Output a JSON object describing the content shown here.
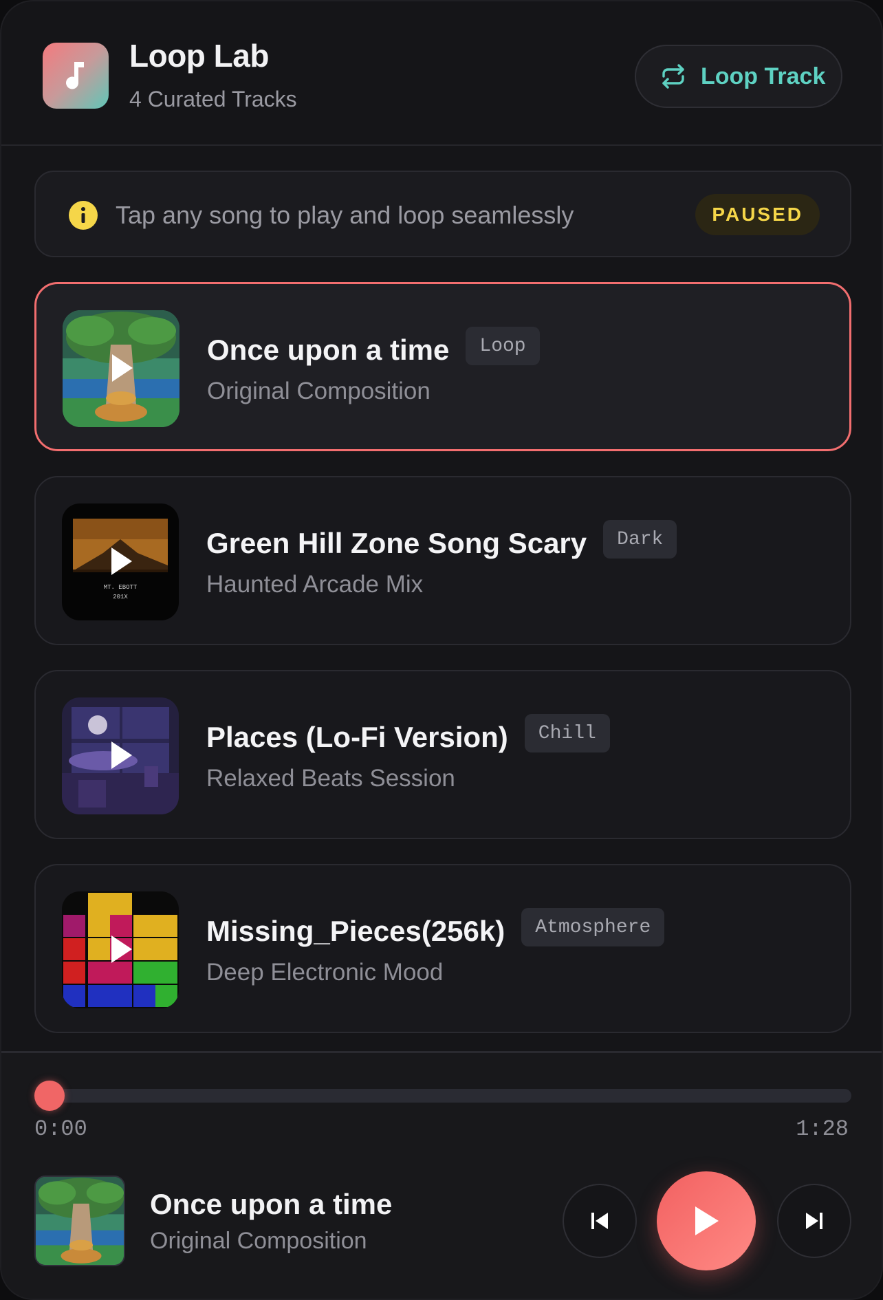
{
  "header": {
    "title": "Loop Lab",
    "subtitle": "4 Curated Tracks",
    "loop_button_label": "Loop Track",
    "logo_icon": "music-note-icon"
  },
  "banner": {
    "text": "Tap any song to play and loop seamlessly",
    "status": "PAUSED",
    "icon": "info-icon"
  },
  "tracks": [
    {
      "title": "Once upon a time",
      "tag": "Loop",
      "subtitle": "Original Composition",
      "active": true
    },
    {
      "title": "Green Hill Zone Song Scary",
      "tag": "Dark",
      "subtitle": "Haunted Arcade Mix",
      "art_text_1": "MT. EBOTT",
      "art_text_2": "201X"
    },
    {
      "title": "Places (Lo-Fi Version)",
      "tag": "Chill",
      "subtitle": "Relaxed Beats Session"
    },
    {
      "title": "Missing_Pieces(256k)",
      "tag": "Atmosphere",
      "subtitle": "Deep Electronic Mood"
    }
  ],
  "player": {
    "current_time": "0:00",
    "total_time": "1:28",
    "progress": 0,
    "now_playing_title": "Once upon a time",
    "now_playing_subtitle": "Original Composition"
  },
  "colors": {
    "accent": "#f26e6f",
    "loop_accent": "#5ed1c2",
    "status": "#f5d649",
    "background": "#151518"
  }
}
